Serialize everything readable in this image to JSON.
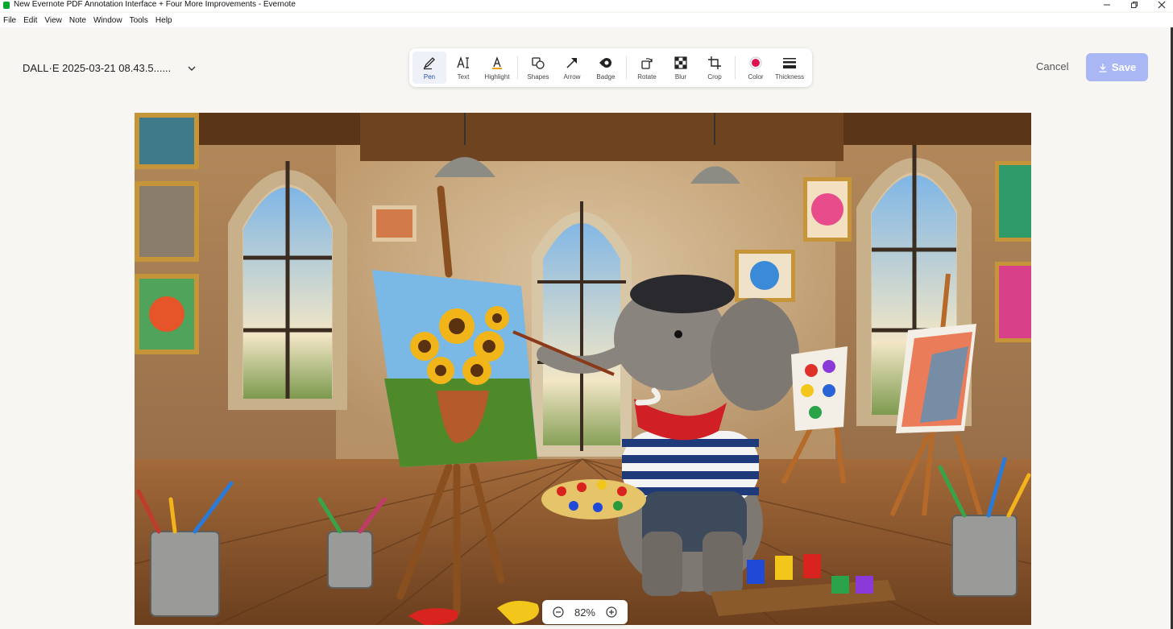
{
  "window": {
    "title": "New Evernote PDF Annotation Interface + Four More Improvements - Evernote",
    "controls": [
      "minimize-icon",
      "restore-icon",
      "close-icon"
    ]
  },
  "menubar": {
    "items": [
      "File",
      "Edit",
      "View",
      "Note",
      "Window",
      "Tools",
      "Help"
    ]
  },
  "header": {
    "filename": "DALL·E 2025-03-21 08.43.5......",
    "cancel_label": "Cancel",
    "save_label": "Save"
  },
  "toolbar": {
    "tools": [
      {
        "label": "Pen",
        "icon": "pen-icon",
        "active": true
      },
      {
        "label": "Text",
        "icon": "text-icon"
      },
      {
        "label": "Highlight",
        "icon": "highlight-icon"
      },
      {
        "label": "Shapes",
        "icon": "shapes-icon"
      },
      {
        "label": "Arrow",
        "icon": "arrow-icon"
      },
      {
        "label": "Badge",
        "icon": "badge-icon"
      },
      {
        "label": "Rotate",
        "icon": "rotate-icon"
      },
      {
        "label": "Blur",
        "icon": "blur-icon"
      },
      {
        "label": "Crop",
        "icon": "crop-icon"
      },
      {
        "label": "Color",
        "icon": "color-swatch-icon",
        "color": "#e0104f"
      },
      {
        "label": "Thickness",
        "icon": "thickness-icon"
      }
    ]
  },
  "canvas": {
    "image_subject": "elephant-painter-illustration"
  },
  "zoom": {
    "value": "82%"
  },
  "colors": {
    "save_disabled": "#a9b8f5",
    "active_tool_bg": "#eef1f7",
    "pen_color": "#e0104f"
  }
}
